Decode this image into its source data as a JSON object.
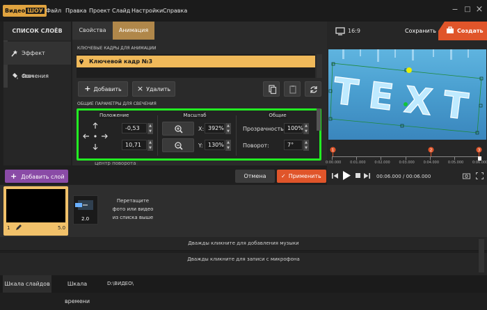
{
  "app": {
    "logo_main": "Видео",
    "logo_sub": "ШОУ"
  },
  "menu": [
    "Файл",
    "Правка",
    "Проект",
    "Слайд",
    "Настройки",
    "Справка"
  ],
  "window": {
    "minimize": "−",
    "maximize": "□",
    "close": "×"
  },
  "layers": {
    "title": "СПИСОК СЛОЁВ",
    "items": [
      {
        "label": "Эффект свечения",
        "icon": "wand-icon"
      },
      {
        "label": "Фон",
        "icon": "paint-bucket-icon"
      }
    ],
    "add_button": "Добавить слой"
  },
  "tabs": [
    {
      "label": "Свойства"
    },
    {
      "label": "Анимация",
      "active": true
    }
  ],
  "keyframes": {
    "section_title": "КЛЮЧЕВЫЕ КАДРЫ ДЛЯ АНИМАЦИИ",
    "selected": "Ключевой кадр №3",
    "add_button": "Добавить",
    "delete_button": "Удалить"
  },
  "params": {
    "section_title": "ОБЩИЕ ПАРАМЕТРЫ ДЛЯ СВЕЧЕНИЯ",
    "position_label": "Положение",
    "pos_x": "-0,53",
    "pos_y": "10,71",
    "scale_label": "Масштаб",
    "scale_x_label": "X:",
    "scale_x": "392%",
    "scale_y_label": "Y:",
    "scale_y": "130%",
    "general_label": "Общие",
    "opacity_label": "Прозрачность:",
    "opacity": "100%",
    "rotation_label": "Поворот:",
    "rotation": "7°",
    "hidden_next": "Центр поворота"
  },
  "actions": {
    "cancel": "Отмена",
    "apply": "Применить"
  },
  "preview": {
    "ratio": "16:9",
    "save": "Сохранить",
    "create": "Создать",
    "text": "TEXT",
    "timeline_ticks": [
      "0:00.000",
      "0:01.000",
      "0:02.000",
      "0:03.000",
      "0:04.000",
      "0:05.000",
      "0:06.000"
    ],
    "keyframe_markers": [
      "1",
      "2",
      "3"
    ],
    "time": "00:06.000 / 00:06.000"
  },
  "slides": {
    "slide_number": "1",
    "slide_duration": "5.0",
    "transition_duration": "2.0",
    "drop_hint_line1": "Перетащите",
    "drop_hint_line2": "фото или видео",
    "drop_hint_line3": "из списка выше"
  },
  "tracks": {
    "music_hint": "Дважды кликните для добавления музыки",
    "mic_hint": "Дважды кликните для записи с микрофона"
  },
  "bottom": {
    "storyboard": "Шкала слайдов",
    "timeline": "Шкала времени",
    "path": "D:\\ВИДЕО\\"
  },
  "colors": {
    "accent_orange": "#e0552a",
    "highlight_green": "#22ee22",
    "logo_gold": "#e0a33f",
    "purple": "#8a4ba6"
  }
}
